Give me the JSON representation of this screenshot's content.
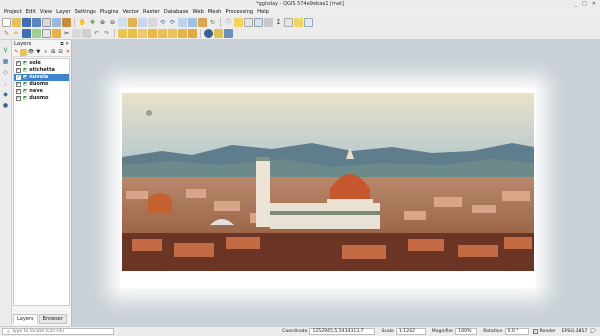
{
  "window": {
    "title": "*ggisday - QGIS 574e9ebaa1 [mat]",
    "controls": [
      "_",
      "□",
      "✕"
    ]
  },
  "menubar": {
    "items": [
      "Project",
      "Edit",
      "View",
      "Layer",
      "Settings",
      "Plugins",
      "Vector",
      "Raster",
      "Database",
      "Web",
      "Mesh",
      "Processing",
      "Help"
    ]
  },
  "layers_panel": {
    "title": "Layers",
    "layers": [
      {
        "name": "sole",
        "checked": true,
        "selected": false
      },
      {
        "name": "etichetta",
        "checked": true,
        "selected": false
      },
      {
        "name": "nuvola",
        "checked": true,
        "selected": true
      },
      {
        "name": "duomo",
        "checked": true,
        "selected": false
      },
      {
        "name": "neve",
        "checked": true,
        "selected": false
      },
      {
        "name": "duomo",
        "checked": true,
        "selected": false
      }
    ],
    "tabs": [
      "Layers",
      "Browser"
    ]
  },
  "statusbar": {
    "locate_placeholder": "Type to locate (Ctrl+K)",
    "coordinate_label": "Coordinate",
    "coordinate_value": "1252945,5,5434313,7",
    "scale_label": "Scale",
    "scale_value": "1:1242",
    "magnifier_label": "Magnifier",
    "magnifier_value": "100%",
    "rotation_label": "Rotation",
    "rotation_value": "0,0 °",
    "render_label": "Render",
    "crs_label": "EPSG:3857"
  },
  "colors": {
    "selection": "#3d84cc",
    "canvas_bg": "#c9d1d6"
  }
}
